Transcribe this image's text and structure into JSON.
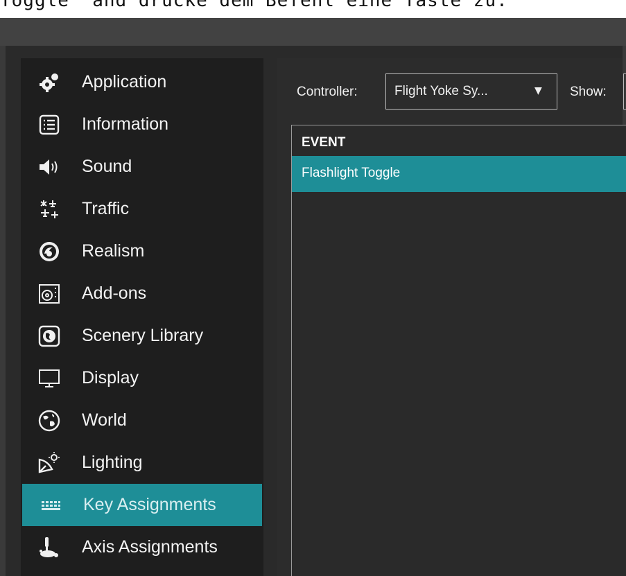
{
  "caption": "Toggle\" and drücke dem Befehl eine Taste zu.",
  "sidebar": {
    "items": [
      {
        "label": "Application",
        "icon": "gear-splat-icon"
      },
      {
        "label": "Information",
        "icon": "list-icon"
      },
      {
        "label": "Sound",
        "icon": "speaker-icon"
      },
      {
        "label": "Traffic",
        "icon": "airplanes-icon"
      },
      {
        "label": "Realism",
        "icon": "realism-icon"
      },
      {
        "label": "Add-ons",
        "icon": "addons-icon"
      },
      {
        "label": "Scenery Library",
        "icon": "globe-box-icon"
      },
      {
        "label": "Display",
        "icon": "monitor-icon"
      },
      {
        "label": "World",
        "icon": "globe-icon"
      },
      {
        "label": "Lighting",
        "icon": "lighting-icon"
      },
      {
        "label": "Key Assignments",
        "icon": "keyboard-icon",
        "active": true
      },
      {
        "label": "Axis Assignments",
        "icon": "joystick-icon"
      }
    ]
  },
  "main": {
    "controller_label": "Controller:",
    "controller_value": "Flight Yoke Sy...",
    "show_label": "Show:",
    "table": {
      "header": "EVENT",
      "rows": [
        "Flashlight Toggle"
      ]
    }
  },
  "colors": {
    "accent": "#1e8e97",
    "sidebar_bg": "#1e1e1e",
    "panel_bg": "#2c2c2c"
  }
}
